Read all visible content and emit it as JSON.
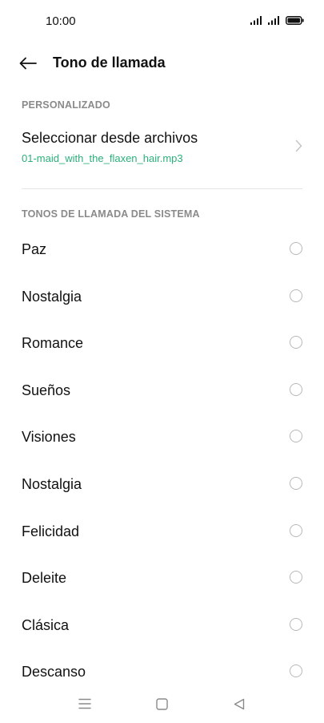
{
  "status_bar": {
    "time": "10:00",
    "icons": [
      "signal-icon",
      "signal-icon",
      "battery-icon"
    ]
  },
  "header": {
    "title": "Tono de llamada",
    "back_icon": "back-arrow-icon"
  },
  "custom_section": {
    "label": "PERSONALIZADO",
    "item_title": "Seleccionar desde archivos",
    "item_file": "01-maid_with_the_flaxen_hair.mp3",
    "chevron_icon": "chevron-right-icon"
  },
  "system_section": {
    "label": "TONOS DE LLAMADA DEL SISTEMA",
    "tones": [
      {
        "label": "Paz",
        "selected": false
      },
      {
        "label": "Nostalgia",
        "selected": false
      },
      {
        "label": "Romance",
        "selected": false
      },
      {
        "label": "Sueños",
        "selected": false
      },
      {
        "label": "Visiones",
        "selected": false
      },
      {
        "label": "Nostalgia",
        "selected": false
      },
      {
        "label": "Felicidad",
        "selected": false
      },
      {
        "label": "Deleite",
        "selected": false
      },
      {
        "label": "Clásica",
        "selected": false
      },
      {
        "label": "Descanso",
        "selected": false
      }
    ]
  },
  "nav_bar": {
    "icons": [
      "menu-icon",
      "home-square-icon",
      "back-triangle-icon"
    ]
  },
  "colors": {
    "accent_green": "#2bb07a",
    "section_label_gray": "#8a8a8a",
    "radio_border": "#b8b8b8"
  }
}
